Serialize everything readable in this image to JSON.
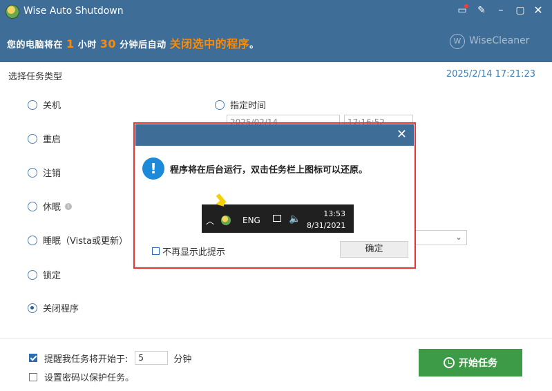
{
  "window": {
    "title": "Wise Auto Shutdown",
    "brand": "WiseCleaner",
    "brand_logo_letter": "W"
  },
  "banner": {
    "prefix": "您的电脑将在",
    "hours": "1",
    "hours_unit": "小时",
    "minutes": "30",
    "minutes_unit": "分钟后自动",
    "action": "关闭选中的程序",
    "suffix": "。"
  },
  "section_title": "选择任务类型",
  "datetime": "2025/2/14 17:21:23",
  "tasks": {
    "shutdown": "关机",
    "restart": "重启",
    "logoff": "注销",
    "hibernate": "休眠",
    "sleep": "睡眠（Vista或更新）",
    "lock": "锁定",
    "close_program": "关闭程序",
    "selected": "关闭程序"
  },
  "schedule": {
    "specified_time": "指定时间",
    "date_value": "2025/02/14",
    "time_value": "17:16:52"
  },
  "footer": {
    "remind_label": "提醒我任务将开始于:",
    "remind_value": "5",
    "remind_unit": "分钟",
    "remind_checked": true,
    "password_label": "设置密码以保护任务。",
    "password_checked": false,
    "start_button": "开始任务"
  },
  "dialog": {
    "message": "程序将在后台运行，双击任务栏上图标可以还原。",
    "taskbar_lang": "ENG",
    "taskbar_time": "13:53",
    "taskbar_date": "8/31/2021",
    "dont_show_label": "不再显示此提示",
    "ok_button": "确定"
  },
  "colors": {
    "titlebar": "#3e6d98",
    "highlight": "#ff8a00",
    "start_button": "#3d9a47",
    "dialog_outline": "#e53935",
    "info_icon": "#1c8ad8"
  }
}
